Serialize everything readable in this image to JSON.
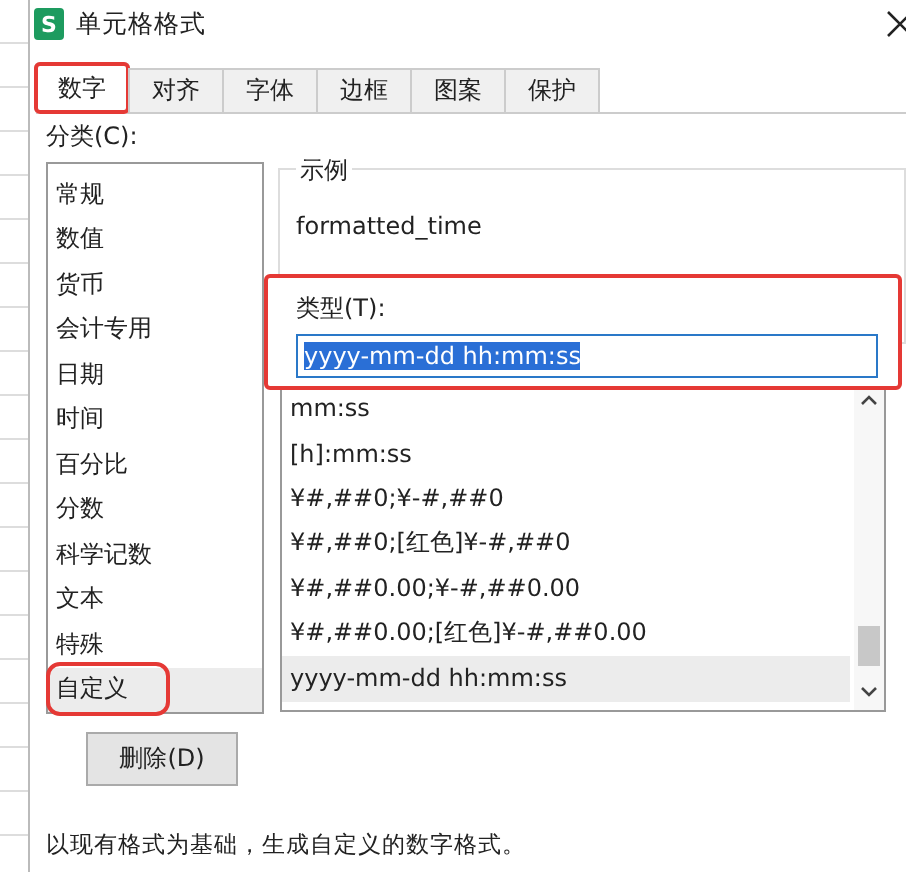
{
  "window": {
    "title": "单元格格式",
    "icon": "S"
  },
  "tabs": [
    {
      "label": "数字",
      "selected": true,
      "highlighted": true
    },
    {
      "label": "对齐",
      "selected": false,
      "highlighted": false
    },
    {
      "label": "字体",
      "selected": false,
      "highlighted": false
    },
    {
      "label": "边框",
      "selected": false,
      "highlighted": false
    },
    {
      "label": "图案",
      "selected": false,
      "highlighted": false
    },
    {
      "label": "保护",
      "selected": false,
      "highlighted": false
    }
  ],
  "category": {
    "label": "分类(C):",
    "items": [
      {
        "label": "常规",
        "selected": false,
        "highlighted": false
      },
      {
        "label": "数值",
        "selected": false,
        "highlighted": false
      },
      {
        "label": "货币",
        "selected": false,
        "highlighted": false
      },
      {
        "label": "会计专用",
        "selected": false,
        "highlighted": false
      },
      {
        "label": "日期",
        "selected": false,
        "highlighted": false
      },
      {
        "label": "时间",
        "selected": false,
        "highlighted": false
      },
      {
        "label": "百分比",
        "selected": false,
        "highlighted": false
      },
      {
        "label": "分数",
        "selected": false,
        "highlighted": false
      },
      {
        "label": "科学记数",
        "selected": false,
        "highlighted": false
      },
      {
        "label": "文本",
        "selected": false,
        "highlighted": false
      },
      {
        "label": "特殊",
        "selected": false,
        "highlighted": false
      },
      {
        "label": "自定义",
        "selected": true,
        "highlighted": true
      }
    ]
  },
  "sample": {
    "label": "示例",
    "value": "formatted_time"
  },
  "type": {
    "label": "类型(T):",
    "value": "yyyy-mm-dd hh:mm:ss",
    "highlighted": true,
    "items": [
      {
        "label": "mm:ss",
        "selected": false
      },
      {
        "label": "[h]:mm:ss",
        "selected": false
      },
      {
        "label": "¥#,##0;¥-#,##0",
        "selected": false
      },
      {
        "label": "¥#,##0;[红色]¥-#,##0",
        "selected": false
      },
      {
        "label": "¥#,##0.00;¥-#,##0.00",
        "selected": false
      },
      {
        "label": "¥#,##0.00;[红色]¥-#,##0.00",
        "selected": false
      },
      {
        "label": "yyyy-mm-dd hh:mm:ss",
        "selected": true
      }
    ]
  },
  "delete_button": "删除(D)",
  "description": "以现有格式为基础，生成自定义的数字格式。"
}
